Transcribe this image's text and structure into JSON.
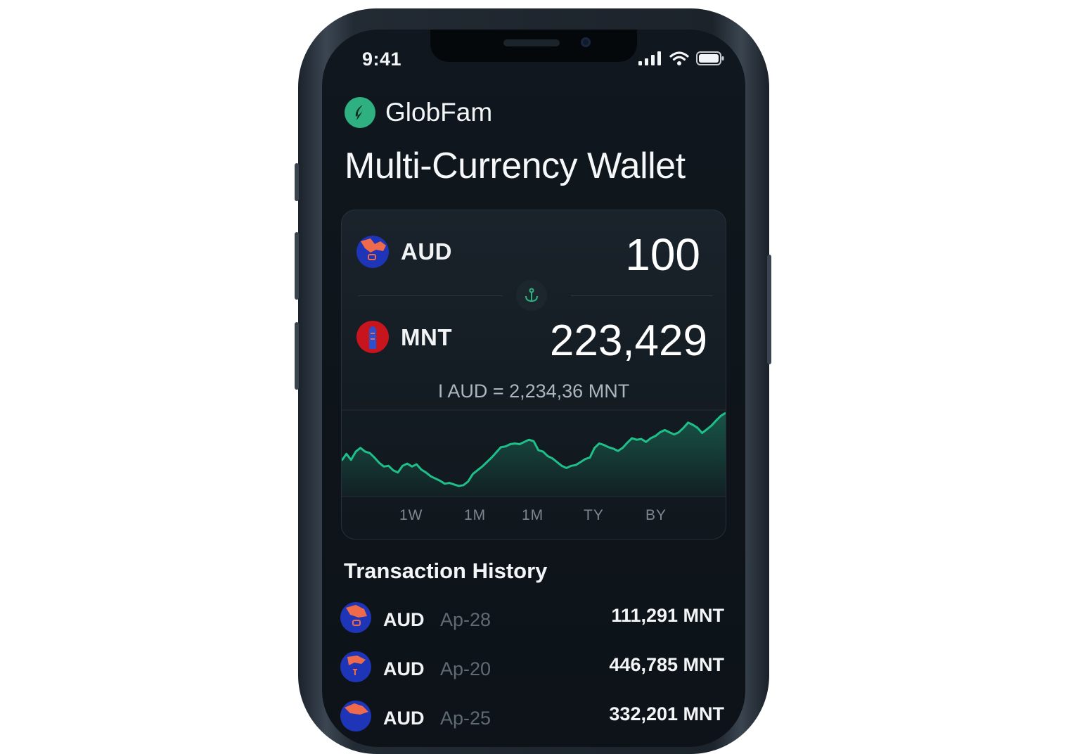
{
  "status_bar": {
    "time": "9:41"
  },
  "app": {
    "name": "GlobFam"
  },
  "page": {
    "title": "Multi-Currency Wallet"
  },
  "converter": {
    "from": {
      "code": "AUD",
      "amount": "100"
    },
    "to": {
      "code": "MNT",
      "amount": "223,429"
    },
    "rate": "I AUD = 2,234,36 MNT",
    "swap_icon": "swap-anchor-icon"
  },
  "chart_data": {
    "type": "area",
    "title": "",
    "xlabel": "",
    "ylabel": "",
    "grid": false,
    "color": "#1fbf8a",
    "values": [
      0.36,
      0.45,
      0.37,
      0.48,
      0.53,
      0.48,
      0.46,
      0.4,
      0.33,
      0.28,
      0.29,
      0.23,
      0.2,
      0.29,
      0.32,
      0.28,
      0.31,
      0.24,
      0.2,
      0.15,
      0.12,
      0.09,
      0.05,
      0.06,
      0.04,
      0.02,
      0.03,
      0.08,
      0.18,
      0.23,
      0.28,
      0.34,
      0.4,
      0.47,
      0.54,
      0.55,
      0.58,
      0.59,
      0.58,
      0.61,
      0.64,
      0.62,
      0.5,
      0.48,
      0.42,
      0.39,
      0.34,
      0.29,
      0.26,
      0.29,
      0.3,
      0.34,
      0.38,
      0.4,
      0.53,
      0.59,
      0.57,
      0.54,
      0.52,
      0.49,
      0.53,
      0.6,
      0.66,
      0.64,
      0.65,
      0.61,
      0.66,
      0.69,
      0.74,
      0.77,
      0.74,
      0.71,
      0.74,
      0.8,
      0.87,
      0.84,
      0.8,
      0.73,
      0.78,
      0.83,
      0.9,
      0.96,
      1.0
    ],
    "ylim": [
      0,
      1
    ]
  },
  "ranges": [
    "1W",
    "1M",
    "1M",
    "TY",
    "BY"
  ],
  "transactions": {
    "title": "Transaction History",
    "items": [
      {
        "currency": "AUD",
        "date": "Ap-28",
        "amount": "111,291 MNT"
      },
      {
        "currency": "AUD",
        "date": "Ap-20",
        "amount": "446,785 MNT"
      },
      {
        "currency": "AUD",
        "date": "Ap-25",
        "amount": "332,201 MNT"
      }
    ]
  },
  "colors": {
    "accent": "#1fbf8a",
    "brand": "#2fb080",
    "background": "#0e151b",
    "aud_flag": "#1f35b8",
    "mnt_flag": "#c8141c"
  }
}
